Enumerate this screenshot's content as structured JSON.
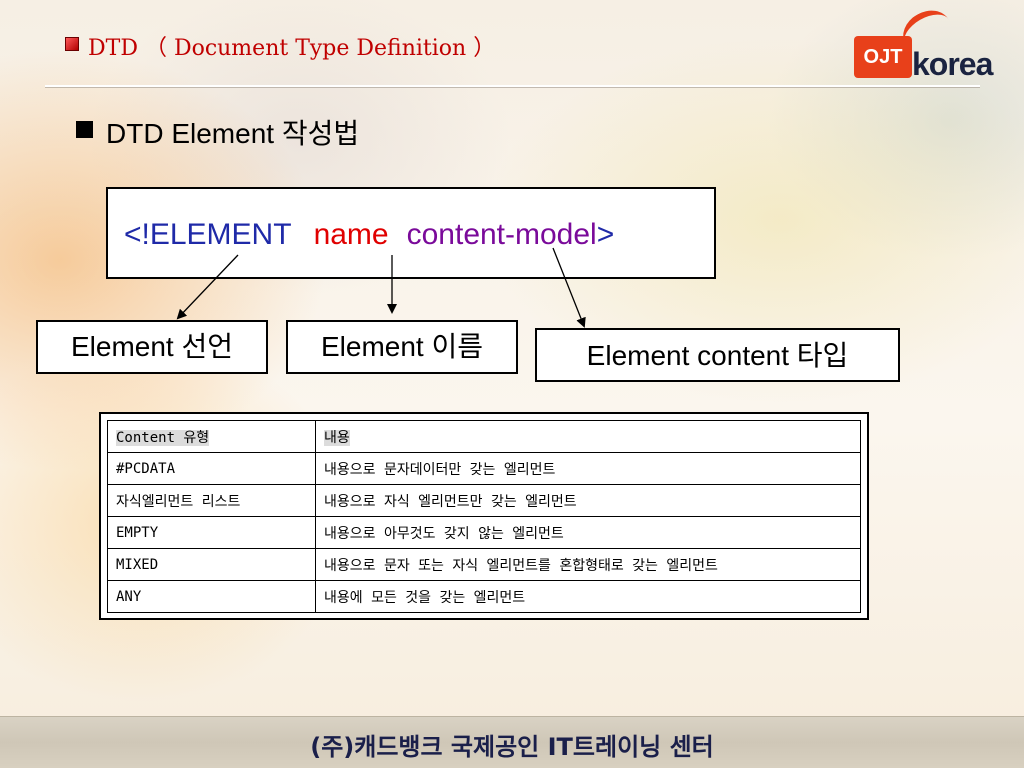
{
  "header": {
    "title": "DTD （ Document Type Definition ）",
    "logo": {
      "badge": "OJT",
      "word": "korea",
      "color": "#e8401a"
    }
  },
  "section": {
    "title": "DTD Element 작성법"
  },
  "syntax": {
    "keyword": "<!ELEMENT",
    "name": "name",
    "model": "content-model",
    "close": ">"
  },
  "labels": {
    "declaration": "Element 선언",
    "name": "Element 이름",
    "content_type": "Element content 타입"
  },
  "table": {
    "headers": [
      "Content 유형",
      "내용"
    ],
    "rows": [
      [
        "#PCDATA",
        "내용으로 문자데이터만 갖는 엘리먼트"
      ],
      [
        "자식엘리먼트 리스트",
        "내용으로 자식 엘리먼트만 갖는 엘리먼트"
      ],
      [
        "EMPTY",
        "내용으로 아무것도 갖지 않는 엘리먼트"
      ],
      [
        "MIXED",
        "내용으로 문자 또는 자식 엘리먼트를 혼합형태로 갖는 엘리먼트"
      ],
      [
        "ANY",
        "내용에 모든 것을 갖는 엘리먼트"
      ]
    ]
  },
  "footer": {
    "text": "(주)캐드뱅크 국제공인 IT트레이닝 센터"
  },
  "colors": {
    "title_red": "#c00000",
    "keyword_blue": "#1f2aa8",
    "name_red": "#e00000",
    "model_purple": "#7a0a9a"
  }
}
